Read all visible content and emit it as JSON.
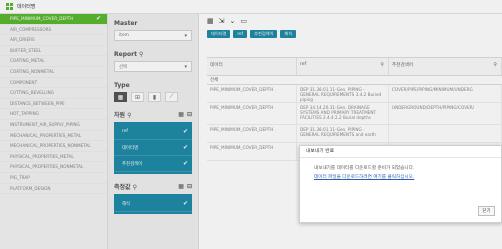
{
  "app": {
    "title": "데이터명"
  },
  "datasets": {
    "selected_index": 0,
    "items": [
      "PIPE_MINIMUM_COVER_DEPTH",
      "AIR_COMPRESSORS",
      "AIR_DRIERS",
      "BUFFER_STEEL",
      "COATING_METAL",
      "COATING_NONMETAL",
      "COMPONENT",
      "CUTTING_BEVELLING",
      "DISTANCE_BETWEEN_PIPE",
      "HOT_TAPPING",
      "INSTRUMENT_AIR_SUPPLY_PIPING",
      "MECHANICAL_PROPERTIES_METAL",
      "MECHANICAL_PROPERTIES_NONMETAL",
      "PHYSICAL_PROPERTIES_METAL",
      "PHYSICAL_PROPERTIES_NONMETAL",
      "PIG_TRAP",
      "PLATFORM_DESIGN"
    ]
  },
  "middle": {
    "master_label": "Master",
    "master_value": "item",
    "report_label": "Report",
    "report_value": "선택",
    "type_label": "Type",
    "fields_label": "차원",
    "fields": [
      "ref",
      "데이터명",
      "추천검색어"
    ],
    "measures_label": "측정값",
    "measures": [
      "해석"
    ]
  },
  "right": {
    "chips": [
      "데이터명",
      "ref",
      "추천검색어",
      "해석"
    ],
    "columns": [
      "데이터",
      "ref",
      "추천검색어"
    ],
    "filter_label": "전체",
    "rows": [
      [
        "PIPE_MINIMUM_COVER_DEPTH",
        "DEP 31.38.01.11-Gen. PIPING - GENERAL REQUIREMENTS 3.4.2 Buried piping",
        "COVER/PIPE/PIPING/MINIMUM/UNDERG"
      ],
      [
        "PIPE_MINIMUM_COVER_DEPTH",
        "DEP 34.14.20.31-Gen. DRAINAGE SYSTEMS AND PRIMARY TREATMENT FACILITIES 2.4.4.2.2 Burial depths",
        "UNDERGROUND/DEPTH/PIPING/COVER/"
      ],
      [
        "PIPE_MINIMUM_COVER_DEPTH",
        "DEP 31.38.01.11-Gen. PIPING - GENERAL REQUIREMENTS and earth",
        ""
      ],
      [
        "PIPE_MINIMUM_COVER_DEPTH",
        "Pollution... SYSTEM... Minimum...",
        ""
      ]
    ]
  },
  "dialog": {
    "title": "내보내기 완료",
    "line1": "내보내기를 데이터를 다운로드할 준비가 되었습니다.",
    "link": "데이터 파일을 다운로드하려면 여기를 클릭하십시오.",
    "close": "닫기"
  }
}
